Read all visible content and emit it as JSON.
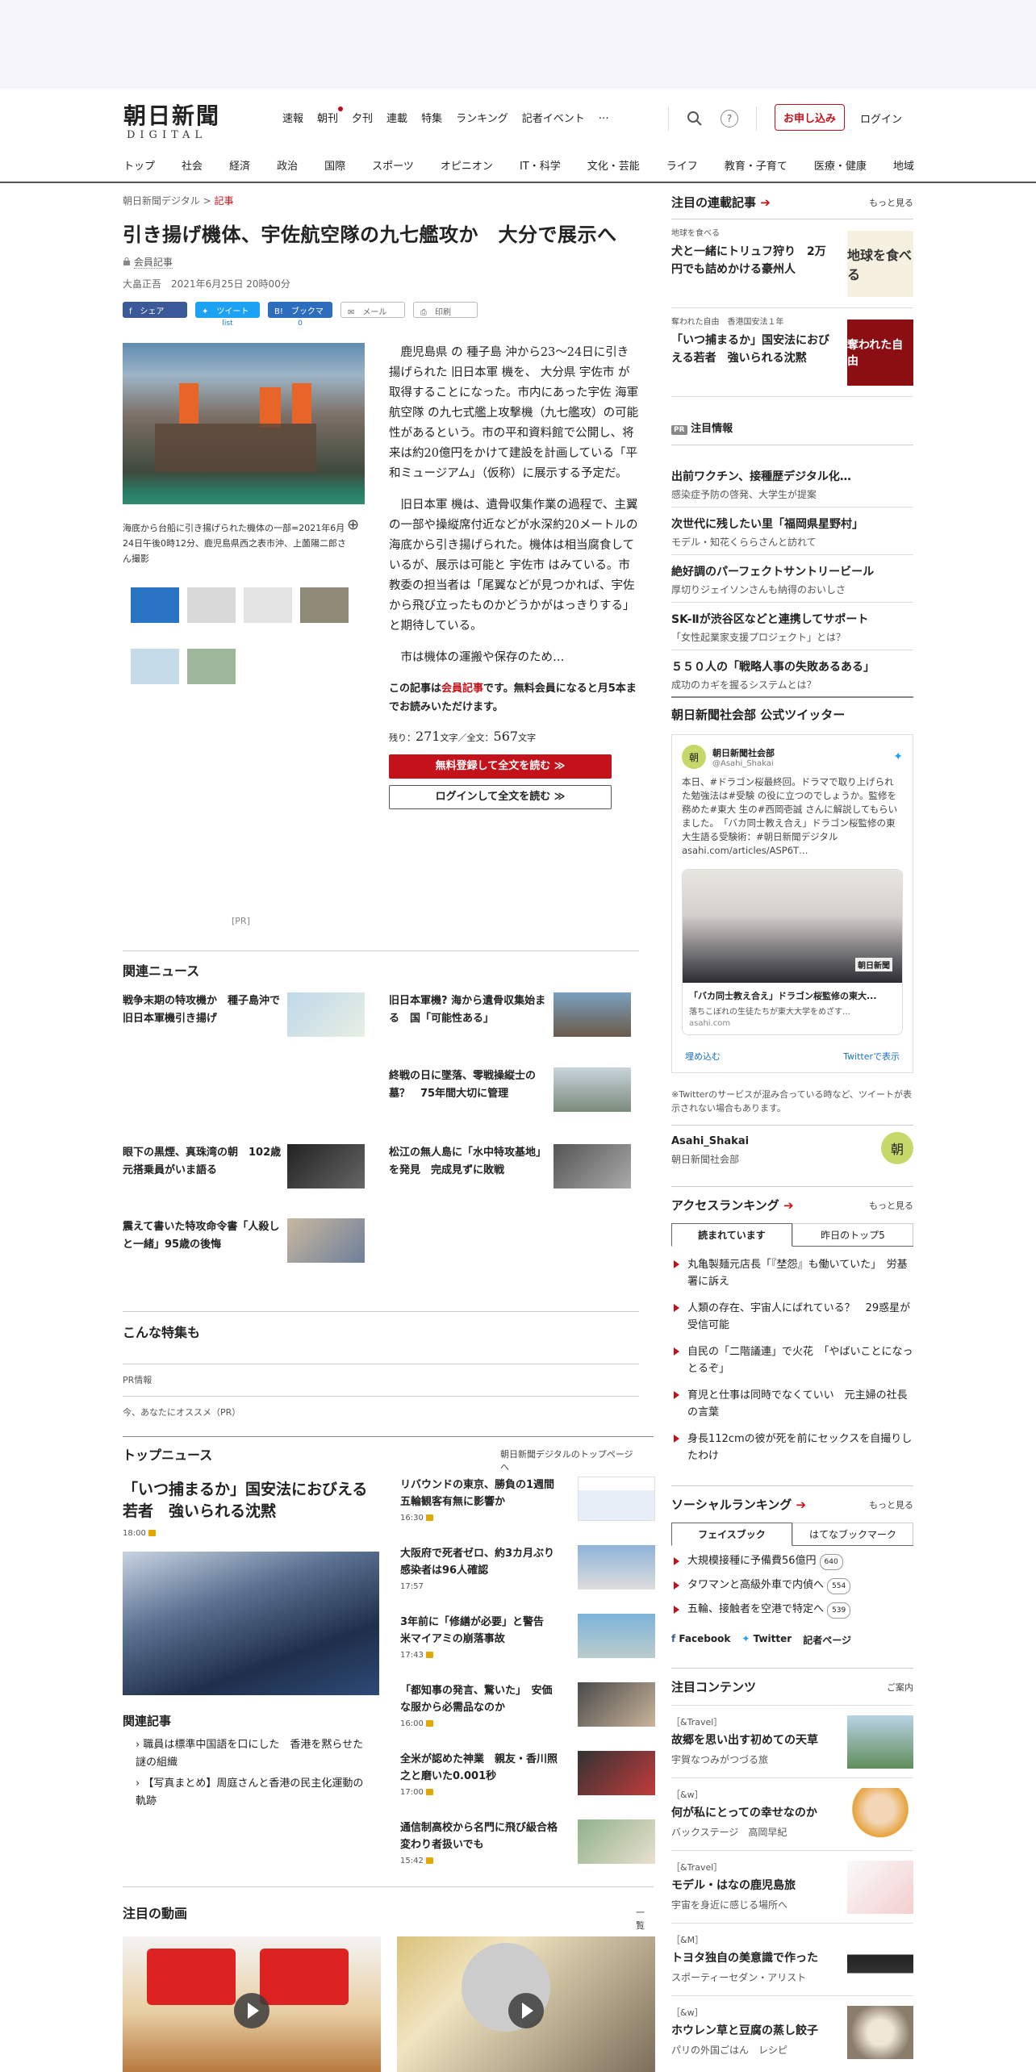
{
  "header": {
    "logo_jp": "朝日新聞",
    "logo_en": "DIGITAL",
    "nav": [
      "速報",
      "朝刊",
      "夕刊",
      "連載",
      "特集",
      "ランキング",
      "記者イベント",
      "…"
    ],
    "subscribe": "お申し込み",
    "login": "ログイン",
    "help": "?"
  },
  "categories": [
    "トップ",
    "社会",
    "経済",
    "政治",
    "国際",
    "スポーツ",
    "オピニオン",
    "IT・科学",
    "文化・芸能",
    "ライフ",
    "教育・子育て",
    "医療・健康",
    "地域"
  ],
  "article": {
    "breadcrumb_site": "朝日新聞デジタル",
    "breadcrumb_sep": ">",
    "breadcrumb_cur": "記事",
    "headline": "引き揚げ機体、宇佐航空隊の九七艦攻か　大分で展示へ",
    "member_label": "会員記事",
    "author": "大畠正吾",
    "date": "2021年6月25日 20時00分",
    "share": {
      "fb": "シェア",
      "tw": "ツイート",
      "bm": "ブックマーク",
      "mail": "メール",
      "print": "印刷",
      "tw_count": "list",
      "bm_count": "0"
    },
    "caption": "海底から台船に引き揚げられた機体の一部=2021年6月24日午後0時12分、鹿児島県西之表市沖、上薗陽二郎さん撮影",
    "paragraphs": [
      "鹿児島県 の 種子島 沖から23～24日に引き揚げられた 旧日本軍 機を、 大分県 宇佐市 が取得することになった。市内にあった宇佐 海軍航空隊 の九七式艦上攻撃機（九七艦攻）の可能性があるという。市の平和資料館で公開し、将来は約20億円をかけて建設を計画している「平和ミュージアム」（仮称）に展示する予定だ。",
      "旧日本軍 機は、遺骨収集作業の過程で、主翼の一部や操縦席付近などが水深約20メートルの海底から引き揚げられた。機体は相当腐食しているが、展示は可能と 宇佐市 はみている。市教委の担当者は「尾翼などが見つかれば、宇佐から飛び立ったものかどうかがはっきりする」と期待している。",
      "市は機体の運搬や保存のため…"
    ],
    "member_note_1": "この記事は",
    "member_note_red": "会員記事",
    "member_note_2": "です。無料会員になると月5本までお読みいただけます。",
    "remain_label": "残り：",
    "remain_num": "271",
    "remain_mid": "文字／全文：",
    "total_num": "567",
    "remain_unit": "文字",
    "btn_free": "無料登録して全文を読む ≫",
    "btn_login": "ログインして全文を読む ≫",
    "pr": "[PR]"
  },
  "related": {
    "title": "関連ニュース",
    "items": [
      "戦争末期の特攻機か　種子島沖で旧日本軍機引き揚げ",
      "旧日本軍機? 海から遺骨収集始まる　国「可能性ある」",
      "終戦の日に墜落、零戦操縦士の墓？　75年間大切に管理",
      "眼下の黒煙、真珠湾の朝　102歳元搭乗員がいま語る",
      "松江の無人島に「水中特攻基地」を発見　完成見ずに敗戦",
      "震えて書いた特攻命令書「人殺しと一緒」95歳の後悔"
    ]
  },
  "special": {
    "title": "こんな特集も",
    "pr1": "PR情報",
    "pr2": "今、あなたにオススメ（PR）"
  },
  "topnews": {
    "title": "トップニュース",
    "link": "朝日新聞デジタルのトップページへ",
    "lead_title": "「いつ捕まるか」国安法におびえる若者　強いられる沈黙",
    "lead_time": "18:00",
    "related_label": "関連記事",
    "related": [
      "職員は標準中国語を口にした　香港を黙らせた謎の組織",
      "【写真まとめ】周庭さんと香港の民主化運動の軌跡"
    ],
    "items": [
      {
        "t": "リバウンドの東京、勝負の1週間　五輪観客有無に影響か",
        "tm": "16:30"
      },
      {
        "t": "大阪府で死者ゼロ、約3カ月ぶり　感染者は96人確認",
        "tm": "17:57"
      },
      {
        "t": "3年前に「修繕が必要」と警告　米マイアミの崩落事故",
        "tm": "17:43"
      },
      {
        "t": "「都知事の発言、驚いた」　安価な服から必需品なのか",
        "tm": "16:00"
      },
      {
        "t": "全米が認めた神業　親友・香川照之と磨いた0.001秒",
        "tm": "17:00"
      },
      {
        "t": "通信制高校から名門に飛び級合格　変わり者扱いでも",
        "tm": "15:42"
      }
    ]
  },
  "video": {
    "title": "注目の動画",
    "more": "一覧"
  },
  "sidebar": {
    "series_title": "注目の連載記事",
    "more": "もっと見る",
    "series": [
      {
        "label": "地球を食べる",
        "title": "犬と一緒にトリュフ狩り　2万円でも詰めかける豪州人",
        "img_text": "地球を食べる"
      },
      {
        "label": "奪われた自由　香港国安法１年",
        "title": "「いつ捕まるか」国安法におびえる若者　強いられる沈黙",
        "img_text": "奪われた自由"
      }
    ],
    "picks_title": "注目情報",
    "pr_badge": "PR",
    "picks": [
      {
        "a": "出前ワクチン、接種歴デジタル化…",
        "b": "感染症予防の啓発、大学生が提案"
      },
      {
        "a": "次世代に残したい里「福岡県星野村」",
        "b": "モデル・知花くららさんと訪れて"
      },
      {
        "a": "絶好調のパーフェクトサントリービール",
        "b": "厚切りジェイソンさんも納得のおいしさ"
      },
      {
        "a": "SK-Ⅱが渋谷区などと連携してサポート",
        "b": "「女性起業家支援プロジェクト」とは？"
      },
      {
        "a": "５５０人の「戦略人事の失敗あるある」",
        "b": "成功のカギを握るシステムとは？"
      }
    ],
    "twitter": {
      "title": "朝日新聞社会部 公式ツイッター",
      "acct": "朝日新聞社会部",
      "handle": "@Asahi_Shakai",
      "tweet": "本日、#ドラゴン桜最終回。ドラマで取り上げられた勉強法は#受験 の役に立つのでしょうか。監修を務めた#東大 生の#西岡壱誠 さんに解説してもらいました。　「バカ同士教え合え」ドラゴン桜監修の東大生語る受験術：#朝日新聞デジタル asahi.com/articles/ASP6T…",
      "card_title": "「バカ同士教え合え」ドラゴン桜監修の東大...",
      "card_desc": "落ちこぼれの生徒たちが東大大学をめざす…",
      "card_domain": "asahi.com",
      "embed": "埋め込む",
      "view": "Twitterで表示",
      "note": "※Twitterのサービスが混み合っている時など、ツイートが表示されない場合もあります。",
      "name": "Asahi_Shakai",
      "sub": "朝日新聞社会部",
      "badge": "朝",
      "card_logo": "朝日新聞"
    },
    "ranking": {
      "title": "アクセスランキング",
      "tab1": "読まれています",
      "tab2": "昨日のトップ5",
      "items": [
        "丸亀製麺元店長「『埜怨』も働いていた」　労基署に訴え",
        "人類の存在、宇宙人にばれている？　29惑星が受信可能",
        "自民の「二階議連」で火花　「やばいことになっとるぞ」",
        "育児と仕事は同時でなくていい　元主婦の社長の言葉",
        "身長112cmの彼が死を前にセックスを自撮りしたわけ"
      ]
    },
    "social": {
      "title": "ソーシャルランキング",
      "tab1": "フェイスブック",
      "tab2": "はてなブックマーク",
      "items": [
        {
          "t": "大規模接種に予備費56億円",
          "c": "640"
        },
        {
          "t": "タワマンと高級外車で内偵へ",
          "c": "554"
        },
        {
          "t": "五輪、接触者を空港で特定へ",
          "c": "539"
        }
      ],
      "fb": "Facebook",
      "tw": "Twitter",
      "page": "記者ページ"
    },
    "contents": {
      "title": "注目コンテンツ",
      "guide": "ご案内",
      "items": [
        {
          "l": "［&Travel］",
          "t": "故郷を思い出す初めての天草",
          "s": "宇賀なつみがつづる旅"
        },
        {
          "l": "［&w］",
          "t": "何が私にとっての幸せなのか",
          "s": "バックステージ　高岡早紀"
        },
        {
          "l": "［&Travel］",
          "t": "モデル・はなの鹿児島旅",
          "s": "宇宙を身近に感じる場所へ"
        },
        {
          "l": "［&M］",
          "t": "トヨタ独自の美意識で作った",
          "s": "スポーティーセダン・アリスト"
        },
        {
          "l": "［&w］",
          "t": "ホウレン草と豆腐の蒸し餃子",
          "s": "パリの外国ごはん　レシピ"
        }
      ]
    }
  }
}
